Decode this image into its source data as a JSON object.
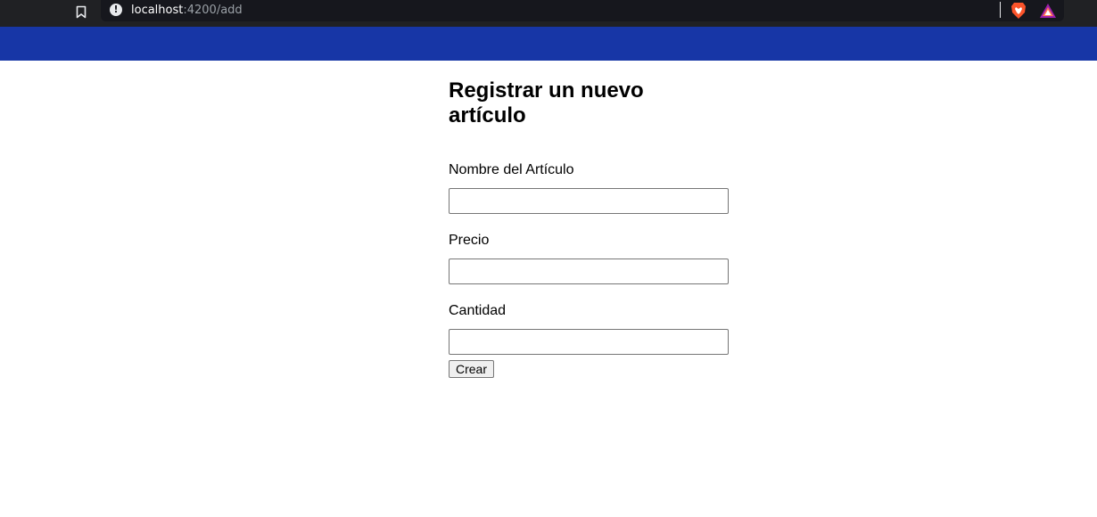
{
  "browser": {
    "url_host": "localhost",
    "url_path": ":4200/add"
  },
  "form": {
    "title": "Registrar un nuevo artículo",
    "fields": [
      {
        "label": "Nombre del Artículo",
        "value": "",
        "placeholder": ""
      },
      {
        "label": "Precio",
        "value": "",
        "placeholder": ""
      },
      {
        "label": "Cantidad",
        "value": "",
        "placeholder": ""
      }
    ],
    "submit_label": "Crear"
  },
  "colors": {
    "app_bar": "#1736a6",
    "chrome_bg": "#202124"
  }
}
